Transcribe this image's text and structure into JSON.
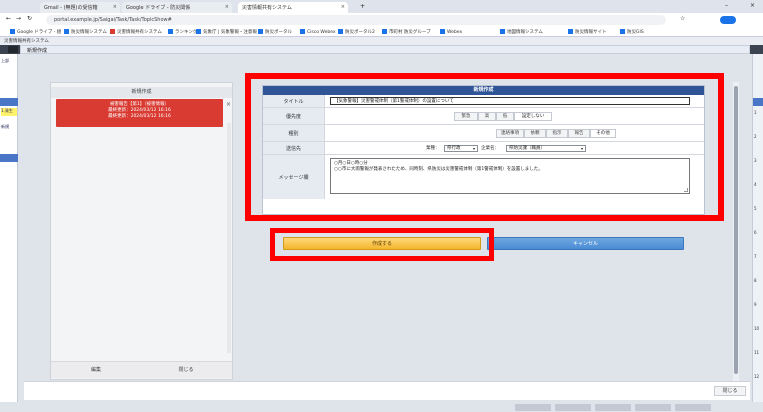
{
  "browser": {
    "tabs": [
      {
        "label": "Gmail - (無題)の受信箱",
        "active": false
      },
      {
        "label": "Google ドライブ - 防災関係",
        "active": false
      },
      {
        "label": "災害情報共有システム",
        "active": true
      }
    ],
    "url": "portal.example.jp/Saigai/Task/Task/TopicShow#",
    "bookmarks": [
      "Google ドライブ - 組",
      "防災情報システム",
      "災害情報共有システム",
      "ランキング",
      "気象庁 | 気象警報・注意報",
      "防災ポータル",
      "Cisco Webex",
      "防災ポータル2",
      "市町村 防災グループ",
      "Webex",
      "地図情報システム",
      "防災情報サイト",
      "防災GIS"
    ]
  },
  "app": {
    "title": "災害情報共有システム",
    "header_label": "新規作成",
    "left_rail": [
      "上部",
      "1.発生",
      "新規"
    ],
    "right_rail": [
      "1",
      "2",
      "3",
      "4",
      "5",
      "6",
      "7",
      "8",
      "9",
      "10",
      "11",
      "12"
    ]
  },
  "left_panel": {
    "header": "新規作成",
    "card_lines": [
      "被害報告【第1】（被害情報）",
      "最終更新：2024/03/12 16:16",
      "最終更新：2024/03/12 16:16"
    ],
    "close": "×",
    "footer_left": "編集",
    "footer_right": "閉じる"
  },
  "form": {
    "header": "新規作成",
    "title_label": "タイトル",
    "title_value": "【気象警報】災害警戒体制（第1警戒体制）の設置について",
    "priority_label": "優先度",
    "priority_options": [
      "緊急",
      "高",
      "低",
      "設定しない"
    ],
    "category_label": "種別",
    "category_options": [
      "連絡事項",
      "依頼",
      "指示",
      "報告",
      "その他"
    ],
    "recipient_label": "送信先",
    "dept_label": "業種：",
    "dept_value": "県行政",
    "org_label": "企業名：",
    "org_value": "県防災課（職員）",
    "message_label": "メッセージ欄",
    "message_lines": [
      "○月○日○時○分",
      "○○市に大雨警報が発表されたため、同時刻、県防災は災害警戒体制（第1警戒体制）を設置しました。"
    ]
  },
  "buttons": {
    "create": "作成する",
    "cancel": "キャンセル",
    "close": "閉じる"
  }
}
